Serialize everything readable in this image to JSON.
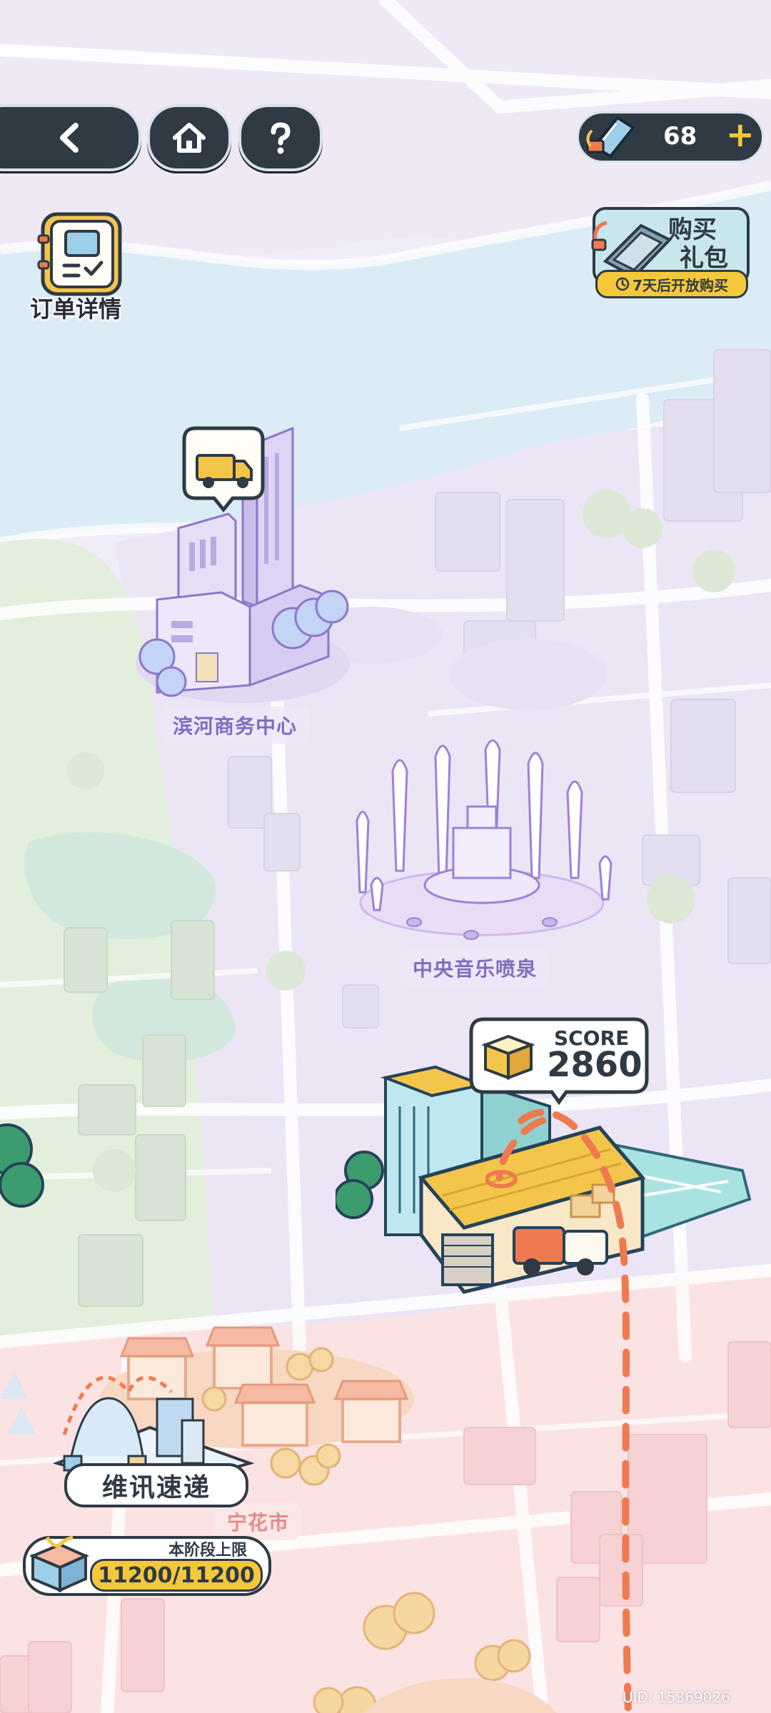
{
  "topbar": {
    "currency_value": "68",
    "currency_plus": "+"
  },
  "side": {
    "order_details_label": "订单详情",
    "gift_pack_title_line1": "购买",
    "gift_pack_title_line2": "礼包",
    "gift_pack_timer": "7天后开放购买"
  },
  "locations": {
    "business_center": "滨河商务中心",
    "fountain": "中央音乐喷泉",
    "flower_market": "宁花市"
  },
  "score": {
    "label": "SCORE",
    "value": "2860"
  },
  "company": {
    "name": "维讯速递",
    "stage_label": "本阶段上限",
    "stage_value": "11200/11200"
  },
  "footer": {
    "uid": "UID: 15369026"
  },
  "colors": {
    "dark_button": "#2f3a45",
    "route": "#ef7a4f",
    "location_text": "#7d6fbf",
    "score_bg": "#ffffff",
    "gold": "#f3c64b"
  },
  "icons": {
    "back": "chevron-left-icon",
    "home": "home-icon",
    "help": "question-icon",
    "currency": "battery-ticket-icon",
    "order": "clipboard-icon",
    "truck": "truck-icon",
    "box": "box-icon"
  }
}
